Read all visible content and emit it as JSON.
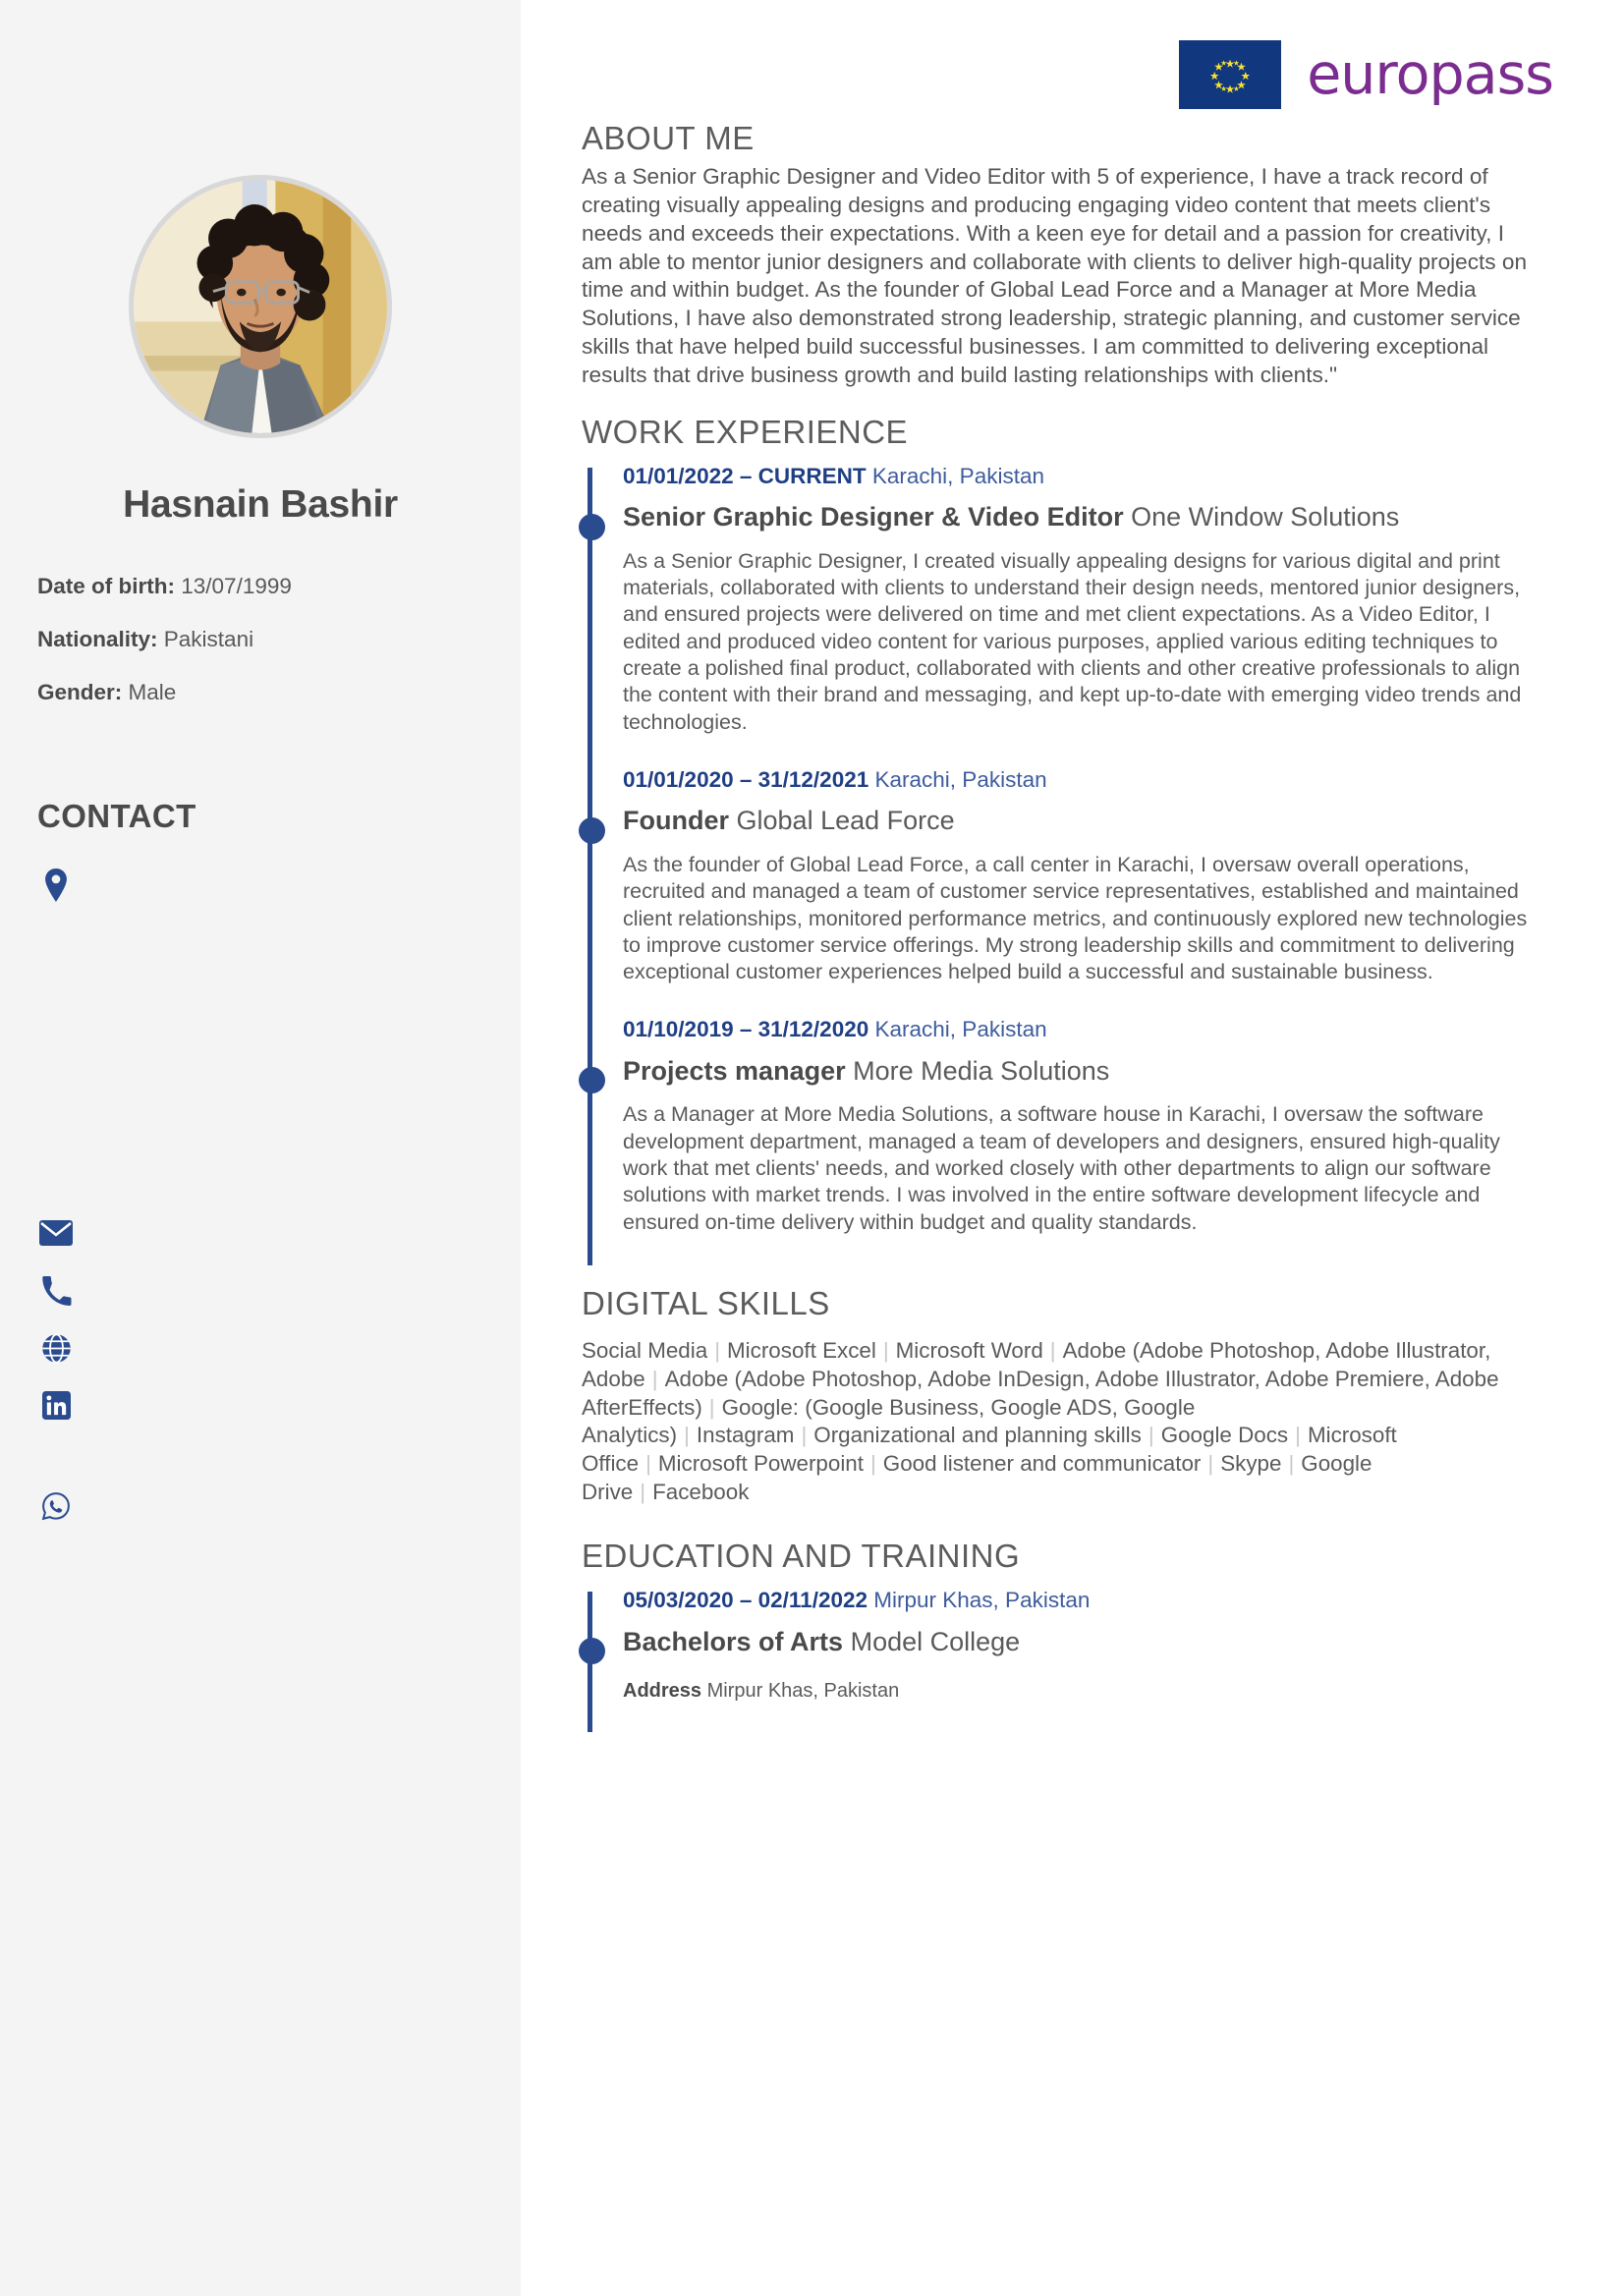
{
  "brand": {
    "name": "europass",
    "flag_color": "#11377f",
    "star_color": "#f8e231",
    "word_color": "#7a2d8f"
  },
  "profile": {
    "name": "Hasnain Bashir",
    "facts": [
      {
        "label": "Date of birth:",
        "value": "13/07/1999"
      },
      {
        "label": "Nationality:",
        "value": "Pakistani"
      },
      {
        "label": "Gender:",
        "value": "Male"
      }
    ]
  },
  "contact": {
    "heading": "CONTACT",
    "items": [
      {
        "icon": "location-pin-icon",
        "value": ""
      },
      {
        "icon": "envelope-icon",
        "value": ""
      },
      {
        "icon": "phone-icon",
        "value": ""
      },
      {
        "icon": "globe-icon",
        "value": ""
      },
      {
        "icon": "linkedin-icon",
        "value": ""
      },
      {
        "icon": "whatsapp-icon",
        "value": ""
      }
    ],
    "icon_color": "#2b4b8f"
  },
  "sections": {
    "about": {
      "heading": "ABOUT ME",
      "body": "As a Senior Graphic Designer and Video Editor with 5 of experience, I have a track record of creating visually appealing designs and producing engaging video content that meets client's needs and exceeds their expectations. With a keen eye for detail and a passion for creativity, I am able to mentor junior designers and collaborate with clients to deliver high-quality projects on time and within budget. As the founder of Global Lead Force and a Manager at More Media Solutions, I have also demonstrated strong leadership, strategic planning, and customer service skills that have helped build successful businesses. I am committed to delivering exceptional results that drive business growth and build lasting relationships with clients.\""
    },
    "work": {
      "heading": "WORK EXPERIENCE",
      "entries": [
        {
          "date": "01/01/2022 – CURRENT",
          "location": "Karachi, Pakistan",
          "role": "Senior Graphic Designer & Video Editor",
          "org": "One Window Solutions",
          "description": "As a Senior Graphic Designer, I created visually appealing designs for various digital and print materials, collaborated with clients to understand their design needs, mentored junior designers, and ensured projects were delivered on time and met client expectations. As a Video Editor, I edited and produced video content for various purposes, applied various editing techniques to create a polished final product, collaborated with clients and other creative professionals to align the content with their brand and messaging, and kept up-to-date with emerging video trends and technologies."
        },
        {
          "date": "01/01/2020 – 31/12/2021",
          "location": "Karachi, Pakistan",
          "role": "Founder",
          "org": "Global Lead Force",
          "description": "As the founder of Global Lead Force, a call center in Karachi, I oversaw overall operations, recruited and managed a team of customer service representatives, established and maintained client relationships, monitored performance metrics, and continuously explored new technologies to improve customer service offerings. My strong leadership skills and commitment to delivering exceptional customer experiences helped build a successful and sustainable business."
        },
        {
          "date": "01/10/2019 – 31/12/2020",
          "location": "Karachi, Pakistan",
          "role": "Projects manager",
          "org": "More Media Solutions",
          "description": "As a Manager at More Media Solutions, a software house in Karachi, I oversaw the software development department, managed a team of developers and designers, ensured high-quality work that met clients' needs, and worked closely with other departments to align our software solutions with market trends. I was involved in the entire software development lifecycle and ensured on-time delivery within budget and quality standards."
        }
      ]
    },
    "digital_skills": {
      "heading": "DIGITAL SKILLS",
      "items": [
        "Social Media",
        "Microsoft Excel",
        "Microsoft Word",
        "Adobe (Adobe Photoshop, Adobe Illustrator, Adobe",
        "Adobe (Adobe Photoshop, Adobe InDesign, Adobe Illustrator, Adobe Premiere, Adobe AfterEffects)",
        "Google: (Google Business, Google ADS, Google Analytics)",
        "Instagram",
        "Organizational and planning skills",
        "Google Docs",
        "Microsoft Office",
        "Microsoft Powerpoint",
        "Good listener and communicator",
        "Skype",
        "Google Drive",
        "Facebook"
      ]
    },
    "education": {
      "heading": "EDUCATION AND TRAINING",
      "entries": [
        {
          "date": "05/03/2020 – 02/11/2022",
          "location": "Mirpur Khas, Pakistan",
          "degree": "Bachelors of Arts",
          "institution": "Model College",
          "address_label": "Address",
          "address_value": "Mirpur Khas, Pakistan"
        }
      ]
    }
  }
}
